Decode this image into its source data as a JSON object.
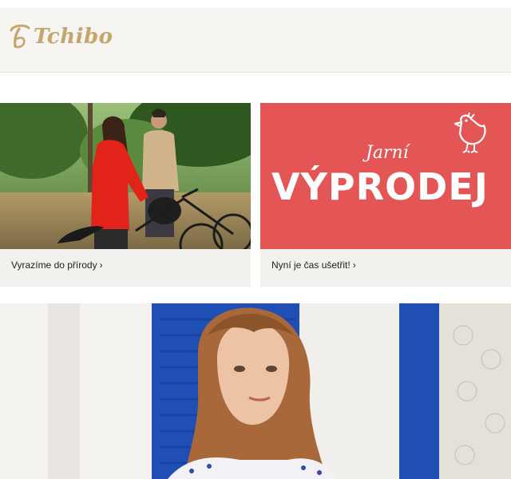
{
  "header": {
    "logo_text": "Tchibo",
    "colors": {
      "background": "#f7f5f2",
      "brand_gold": "#c5a46d"
    }
  },
  "promos": [
    {
      "caption": "Vyrazíme do přírody",
      "arrow": "›",
      "image": "couple-with-bicycles-in-nature"
    },
    {
      "caption": "Nyní je čas ušetřit!",
      "arrow": "›",
      "image": "spring-sale-banner",
      "banner": {
        "kicker": "Jarní",
        "title": "VÝPRODEJ",
        "icon": "bird-icon",
        "color": "#e35655"
      }
    }
  ],
  "hero": {
    "image": "woman-by-blue-shutters"
  }
}
